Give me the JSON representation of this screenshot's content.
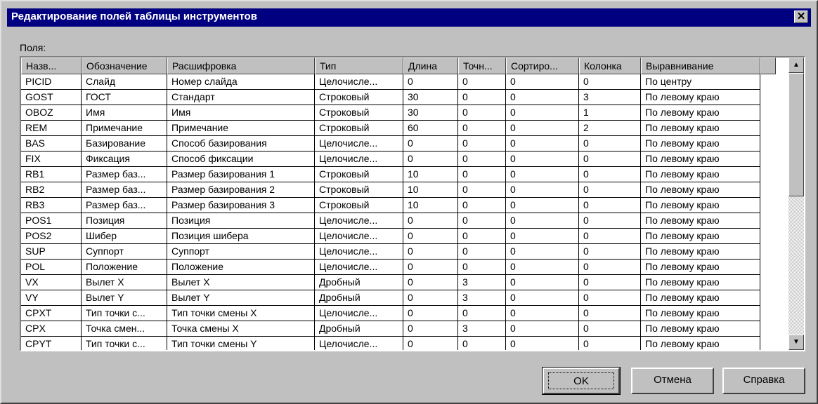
{
  "dialog": {
    "title": "Редактирование полей таблицы инструментов",
    "close_glyph": "✕"
  },
  "fields_label": "Поля:",
  "columns": [
    "Назв...",
    "Обозначение",
    "Расшифровка",
    "Тип",
    "Длина",
    "Точн...",
    "Сортиро...",
    "Колонка",
    "Выравнивание"
  ],
  "rows": [
    [
      "PICID",
      "Слайд",
      "Номер слайда",
      "Целочисле...",
      "0",
      "0",
      "0",
      "0",
      "По центру"
    ],
    [
      "GOST",
      "ГОСТ",
      "Стандарт",
      "Строковый",
      "30",
      "0",
      "0",
      "3",
      "По левому краю"
    ],
    [
      "OBOZ",
      "Имя",
      "Имя",
      "Строковый",
      "30",
      "0",
      "0",
      "1",
      "По левому краю"
    ],
    [
      "REM",
      "Примечание",
      "Примечание",
      "Строковый",
      "60",
      "0",
      "0",
      "2",
      "По левому краю"
    ],
    [
      "BAS",
      "Базирование",
      "Способ базирования",
      "Целочисле...",
      "0",
      "0",
      "0",
      "0",
      "По левому краю"
    ],
    [
      "FIX",
      "Фиксация",
      "Способ фиксации",
      "Целочисле...",
      "0",
      "0",
      "0",
      "0",
      "По левому краю"
    ],
    [
      "RB1",
      "Размер баз...",
      "Размер базирования 1",
      "Строковый",
      "10",
      "0",
      "0",
      "0",
      "По левому краю"
    ],
    [
      "RB2",
      "Размер баз...",
      "Размер базирования 2",
      "Строковый",
      "10",
      "0",
      "0",
      "0",
      "По левому краю"
    ],
    [
      "RB3",
      "Размер баз...",
      "Размер базирования 3",
      "Строковый",
      "10",
      "0",
      "0",
      "0",
      "По левому краю"
    ],
    [
      "POS1",
      "Позиция",
      "Позиция",
      "Целочисле...",
      "0",
      "0",
      "0",
      "0",
      "По левому краю"
    ],
    [
      "POS2",
      "Шибер",
      "Позиция шибера",
      "Целочисле...",
      "0",
      "0",
      "0",
      "0",
      "По левому краю"
    ],
    [
      "SUP",
      "Суппорт",
      "Суппорт",
      "Целочисле...",
      "0",
      "0",
      "0",
      "0",
      "По левому краю"
    ],
    [
      "POL",
      "Положение",
      "Положение",
      "Целочисле...",
      "0",
      "0",
      "0",
      "0",
      "По левому краю"
    ],
    [
      "VX",
      "Вылет X",
      "Вылет X",
      "Дробный",
      "0",
      "3",
      "0",
      "0",
      "По левому краю"
    ],
    [
      "VY",
      "Вылет Y",
      "Вылет Y",
      "Дробный",
      "0",
      "3",
      "0",
      "0",
      "По левому краю"
    ],
    [
      "CPXT",
      "Тип точки с...",
      "Тип точки смены X",
      "Целочисле...",
      "0",
      "0",
      "0",
      "0",
      "По левому краю"
    ],
    [
      "CPX",
      "Точка смен...",
      "Точка смены X",
      "Дробный",
      "0",
      "3",
      "0",
      "0",
      "По левому краю"
    ],
    [
      "CPYT",
      "Тип точки с...",
      "Тип точки смены Y",
      "Целочисле...",
      "0",
      "0",
      "0",
      "0",
      "По левому краю"
    ]
  ],
  "scrollbar": {
    "up_glyph": "▲",
    "down_glyph": "▼"
  },
  "buttons": {
    "ok": "OK",
    "cancel": "Отмена",
    "help": "Справка"
  }
}
